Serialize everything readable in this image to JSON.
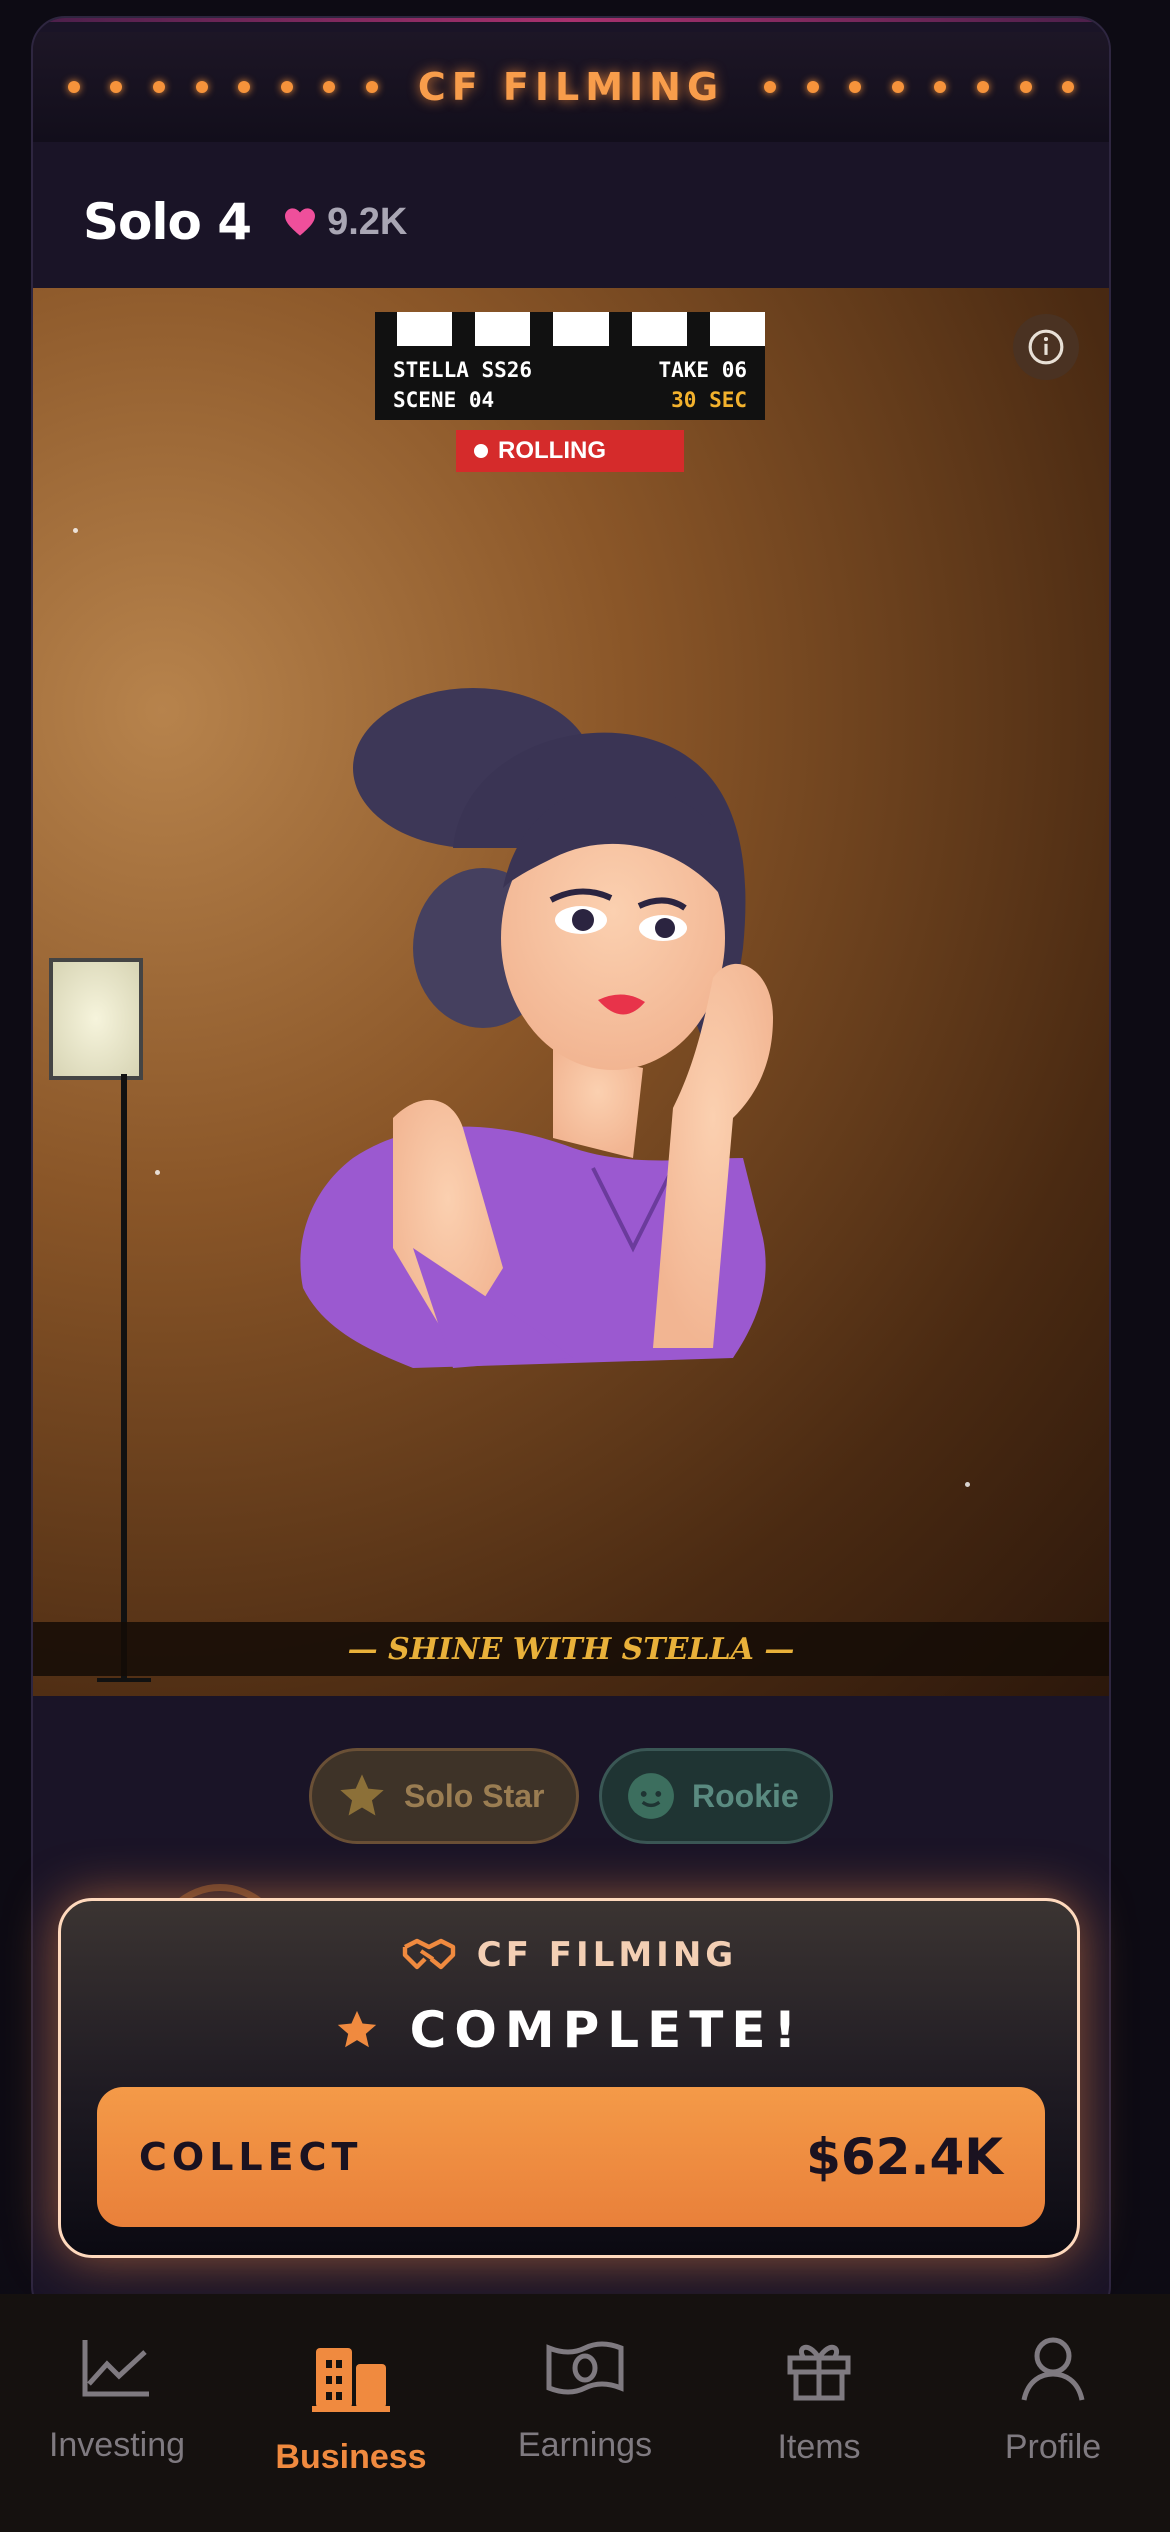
{
  "marquee": {
    "title": "CF FILMING"
  },
  "header": {
    "model_name": "Solo 4",
    "likes": "9.2K"
  },
  "scene": {
    "clapper": {
      "line1_left": "STELLA SS26",
      "line1_right": "TAKE 06",
      "line2_left": "SCENE 04",
      "line2_right": "30 SEC"
    },
    "rolling": "ROLLING",
    "banner": "— SHINE WITH STELLA —"
  },
  "badges": [
    {
      "label": "Solo Star",
      "icon": "star-icon"
    },
    {
      "label": "Rookie",
      "icon": "baby-face-icon"
    }
  ],
  "popup": {
    "title": "CF FILMING",
    "status": "COMPLETE!",
    "button_label": "COLLECT",
    "amount": "$62.4K"
  },
  "nav": {
    "items": [
      {
        "label": "Investing",
        "icon": "line-chart-icon"
      },
      {
        "label": "Business",
        "icon": "buildings-icon",
        "active": true
      },
      {
        "label": "Earnings",
        "icon": "banknote-icon"
      },
      {
        "label": "Items",
        "icon": "gift-icon"
      },
      {
        "label": "Profile",
        "icon": "user-icon"
      }
    ]
  },
  "colors": {
    "accent": "#f08a3f",
    "heart": "#ef4f9b",
    "rolling": "#d52b2b",
    "gold": "#e9b13a"
  }
}
